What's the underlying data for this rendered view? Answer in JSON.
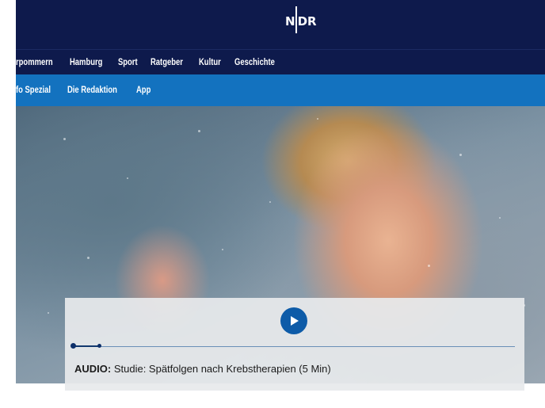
{
  "header": {
    "logo_text": "NDR",
    "logo_left": "N",
    "logo_right": "DR",
    "background": "#0e1a4c"
  },
  "nav_primary": {
    "items": [
      {
        "label": "rpommern"
      },
      {
        "label": "Hamburg"
      },
      {
        "label": "Sport"
      },
      {
        "label": "Ratgeber"
      },
      {
        "label": "Kultur"
      },
      {
        "label": "Geschichte"
      }
    ]
  },
  "nav_secondary": {
    "background": "#1372bf",
    "items": [
      {
        "label": "fo Spezial"
      },
      {
        "label": "Die Redaktion"
      },
      {
        "label": "App"
      }
    ]
  },
  "audio_player": {
    "prefix": "AUDIO:",
    "title": "Studie: Spätfolgen nach Krebstherapien (5 Min)",
    "play_icon": "play-icon",
    "accent": "#0d5ba8"
  }
}
